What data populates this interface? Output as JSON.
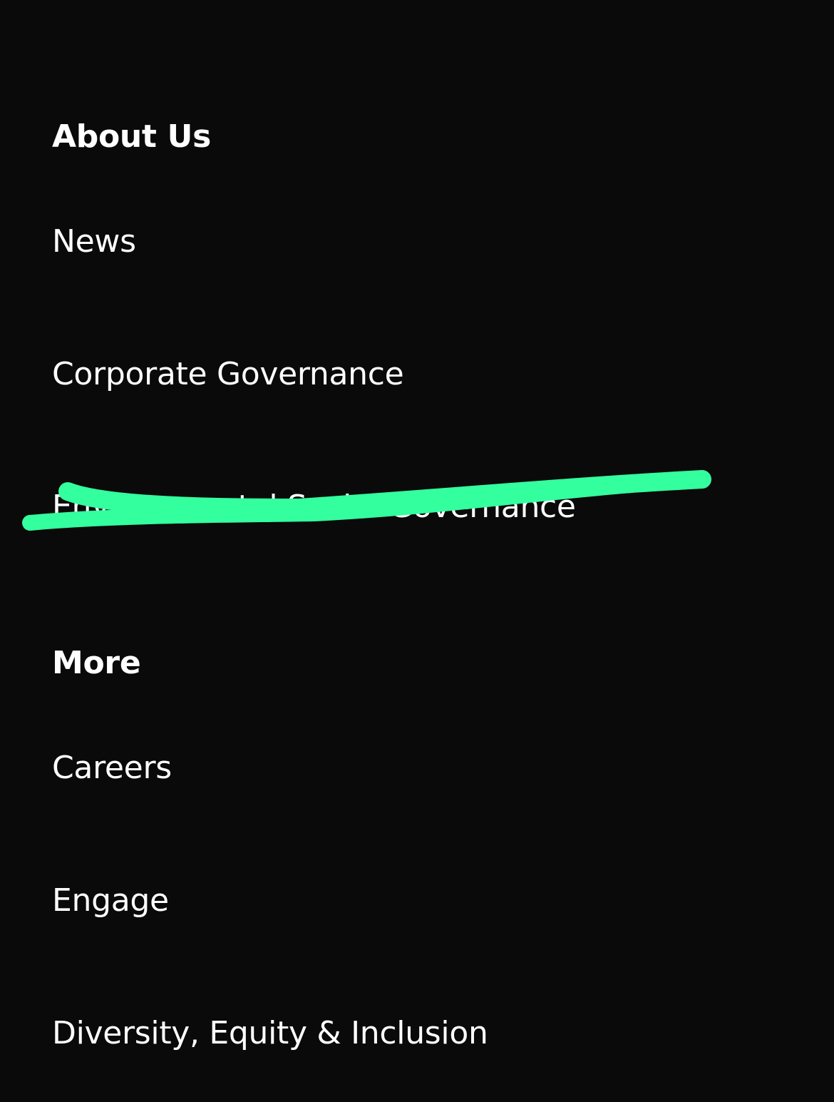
{
  "sections": [
    {
      "heading": "About Us",
      "links": [
        "News",
        "Corporate Governance",
        "Environmental Social Governance"
      ]
    },
    {
      "heading": "More",
      "links": [
        "Careers",
        "Engage",
        "Diversity, Equity & Inclusion"
      ]
    }
  ],
  "redaction_color": "#33ff9f",
  "background_color": "#0a0a0a"
}
